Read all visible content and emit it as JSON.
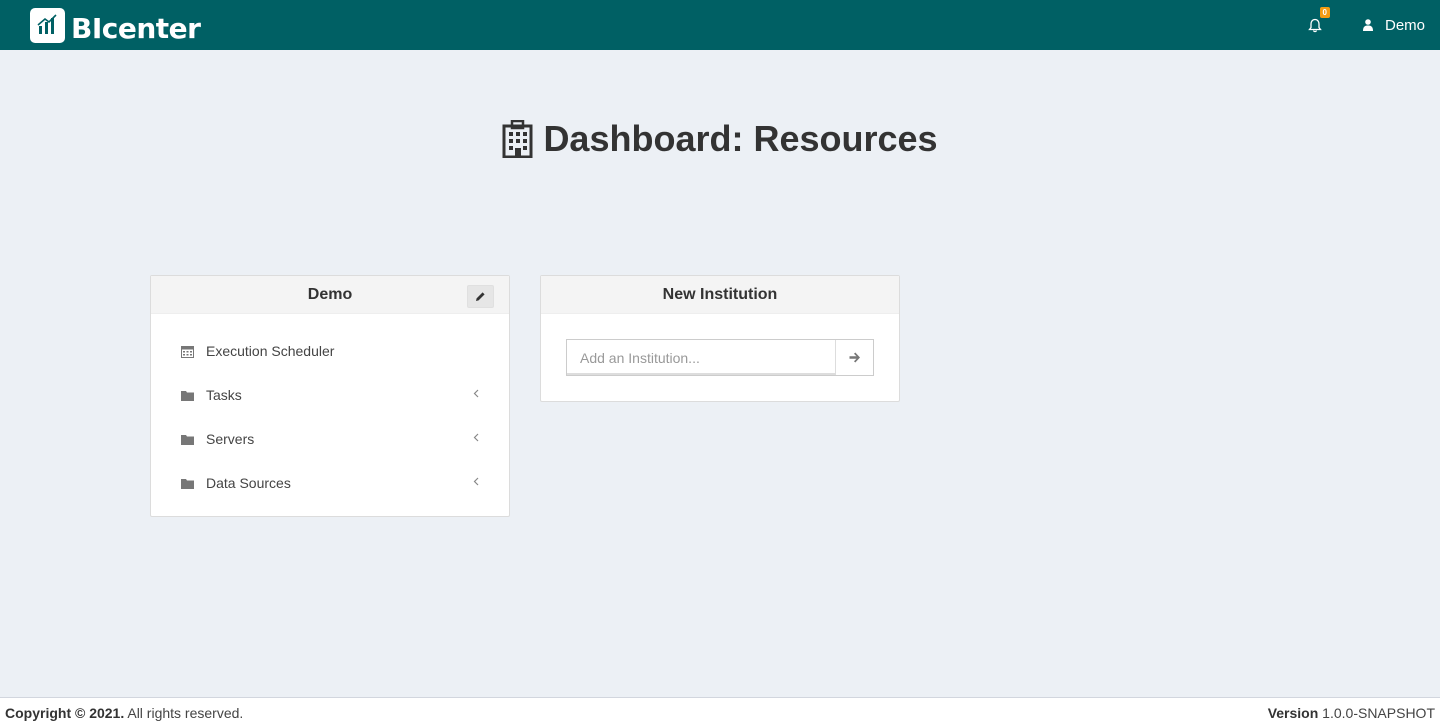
{
  "header": {
    "brand": "BIcenter",
    "notification_count": "0",
    "user_name": "Demo"
  },
  "page": {
    "title": "Dashboard: Resources",
    "title_icon": "building-icon"
  },
  "institution_box": {
    "title": "Demo",
    "edit_icon": "pencil-icon",
    "items": [
      {
        "label": "Execution Scheduler",
        "icon": "calendar-icon",
        "expandable": false
      },
      {
        "label": "Tasks",
        "icon": "folder-icon",
        "expandable": true
      },
      {
        "label": "Servers",
        "icon": "folder-icon",
        "expandable": true
      },
      {
        "label": "Data Sources",
        "icon": "folder-icon",
        "expandable": true
      }
    ]
  },
  "new_institution_box": {
    "title": "New Institution",
    "input_placeholder": "Add an Institution...",
    "submit_icon": "arrow-right-icon"
  },
  "footer": {
    "copyright_bold": "Copyright © 2021.",
    "copyright_rest": " All rights reserved.",
    "version_label": "Version",
    "version_value": " 1.0.0-SNAPSHOT"
  },
  "colors": {
    "header_bg": "#006064",
    "page_bg": "#ecf0f5",
    "badge": "#f39c12"
  }
}
